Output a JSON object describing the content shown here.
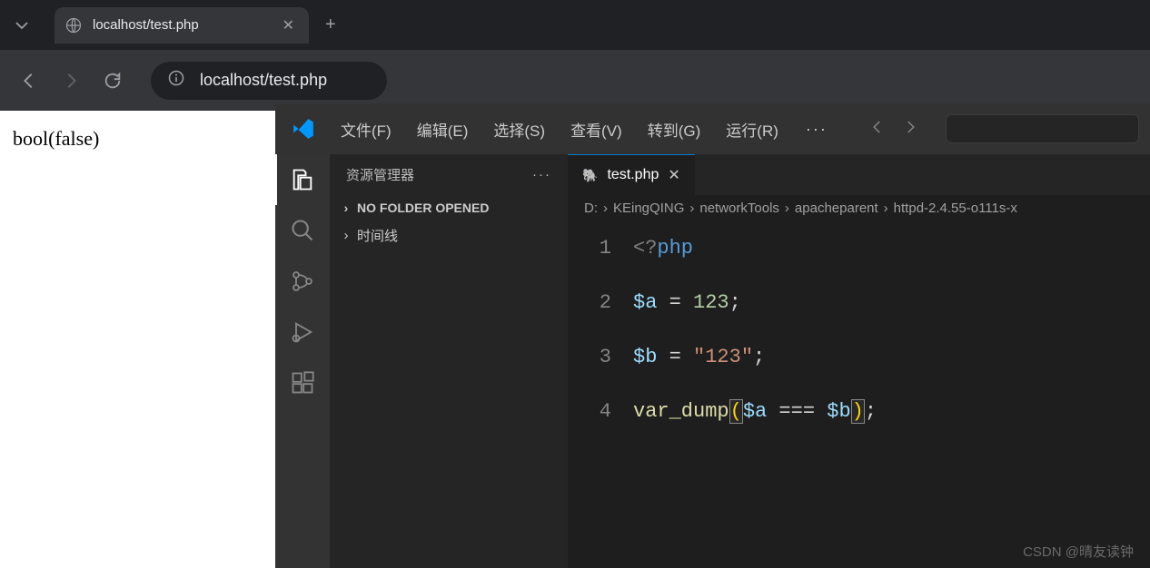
{
  "browser": {
    "tab_title": "localhost/test.php",
    "url": "localhost/test.php"
  },
  "page": {
    "output": "bool(false)"
  },
  "vscode": {
    "menu": {
      "file": "文件(F)",
      "edit": "编辑(E)",
      "select": "选择(S)",
      "view": "查看(V)",
      "go": "转到(G)",
      "run": "运行(R)"
    },
    "sidebar": {
      "title": "资源管理器",
      "no_folder": "NO FOLDER OPENED",
      "timeline": "时间线"
    },
    "tab": {
      "filename": "test.php"
    },
    "breadcrumb": {
      "parts": [
        "D:",
        "KEingQING",
        "networkTools",
        "apacheparent",
        "httpd-2.4.55-o111s-x"
      ]
    },
    "code": {
      "line1": {
        "tag_open": "<?",
        "php": "php"
      },
      "line2": {
        "var": "$a",
        "eq": " = ",
        "num": "123",
        "semi": ";"
      },
      "line3": {
        "var": "$b",
        "eq": " = ",
        "str": "\"123\"",
        "semi": ";"
      },
      "line4": {
        "func": "var_dump",
        "lp": "(",
        "va": "$a",
        "op": " === ",
        "vb": "$b",
        "rp": ")",
        "semi": ";"
      },
      "nums": [
        "1",
        "2",
        "3",
        "4"
      ]
    }
  },
  "watermark": "CSDN @晴友读钟"
}
